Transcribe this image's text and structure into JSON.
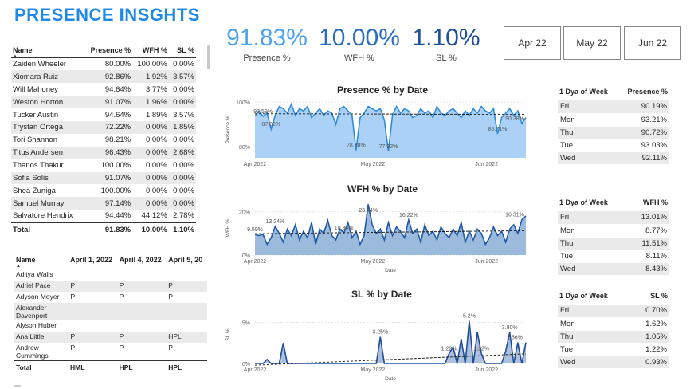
{
  "title": "PRESENCE INSGHTS",
  "kpis": [
    {
      "value": "91.83%",
      "label": "Presence %",
      "color": "#4da3f0"
    },
    {
      "value": "10.00%",
      "label": "WFH %",
      "color": "#2a6cc2"
    },
    {
      "value": "1.10%",
      "label": "SL %",
      "color": "#1f4f9a"
    }
  ],
  "months": [
    "Apr 22",
    "May 22",
    "Jun 22"
  ],
  "employee_table": {
    "headers": [
      "Name",
      "Presence %",
      "WFH %",
      "SL %"
    ],
    "rows": [
      [
        "Zaiden Wheeler",
        "80.00%",
        "100.00%",
        "0.00%"
      ],
      [
        "Xiomara Ruiz",
        "92.86%",
        "1.92%",
        "3.57%"
      ],
      [
        "Will Mahoney",
        "94.64%",
        "3.77%",
        "0.00%"
      ],
      [
        "Weston Horton",
        "91.07%",
        "1.96%",
        "0.00%"
      ],
      [
        "Tucker Austin",
        "94.64%",
        "1.89%",
        "3.57%"
      ],
      [
        "Trystan Ortega",
        "72.22%",
        "0.00%",
        "1.85%"
      ],
      [
        "Tori Shannon",
        "98.21%",
        "0.00%",
        "0.00%"
      ],
      [
        "Titus Andersen",
        "96.43%",
        "0.00%",
        "2.68%"
      ],
      [
        "Thanos Thakur",
        "100.00%",
        "0.00%",
        "0.00%"
      ],
      [
        "Sofia Solis",
        "91.07%",
        "0.00%",
        "0.00%"
      ],
      [
        "Shea Zuniga",
        "100.00%",
        "0.00%",
        "0.00%"
      ],
      [
        "Samuel Murray",
        "97.14%",
        "0.00%",
        "0.00%"
      ],
      [
        "Salvatore Hendrix",
        "94.44%",
        "44.12%",
        "2.78%"
      ]
    ],
    "total": [
      "Total",
      "91.83%",
      "10.00%",
      "1.10%"
    ]
  },
  "attendance_table": {
    "headers": [
      "Name",
      "April 1, 2022",
      "April 4, 2022",
      "April 5, 20"
    ],
    "rows": [
      [
        "Aditya Walls",
        "",
        "",
        ""
      ],
      [
        "Adriel Pace",
        "P",
        "P",
        "P"
      ],
      [
        "Adyson Moyer",
        "P",
        "P",
        "P"
      ],
      [
        "Alexander Davenport",
        "",
        "",
        ""
      ],
      [
        "Alyson Huber",
        "",
        "",
        ""
      ],
      [
        "Ana Little",
        "P",
        "P",
        "HPL"
      ],
      [
        "Andrew Cummings",
        "P",
        "P",
        "P"
      ]
    ],
    "total": [
      "Total",
      "HML",
      "HPL",
      "HPL"
    ]
  },
  "weekday_tables": [
    {
      "headers": [
        "1 Dya of Week",
        "Presence %"
      ],
      "rows": [
        [
          "Fri",
          "90.19%"
        ],
        [
          "Mon",
          "93.21%"
        ],
        [
          "Thu",
          "90.72%"
        ],
        [
          "Tue",
          "93.03%"
        ],
        [
          "Wed",
          "92.11%"
        ]
      ]
    },
    {
      "headers": [
        "1 Dya of Week",
        "WFH %"
      ],
      "rows": [
        [
          "Fri",
          "13.01%"
        ],
        [
          "Mon",
          "8.77%"
        ],
        [
          "Thu",
          "11.51%"
        ],
        [
          "Tue",
          "8.11%"
        ],
        [
          "Wed",
          "8.43%"
        ]
      ]
    },
    {
      "headers": [
        "1 Dya of Week",
        "SL %"
      ],
      "rows": [
        [
          "Fri",
          "0.70%"
        ],
        [
          "Mon",
          "1.62%"
        ],
        [
          "Thu",
          "1.05%"
        ],
        [
          "Tue",
          "1.22%"
        ],
        [
          "Wed",
          "0.93%"
        ]
      ]
    }
  ],
  "chart_data": [
    {
      "type": "area",
      "title": "Presence % by Date",
      "ylabel": "Presence %",
      "xlabel": "",
      "ylim": [
        75,
        100
      ],
      "yticks": [
        "80%",
        "100%"
      ],
      "xticks": [
        "Apr 2022",
        "May 2022",
        "Jun 2022"
      ],
      "fill": "#9ccaf5",
      "line": "#2f8be0",
      "values": [
        93.6,
        96,
        93.59,
        95,
        87.82,
        94,
        98,
        97,
        95,
        99,
        94,
        97,
        96,
        98,
        93,
        95,
        97,
        94,
        96,
        95,
        90,
        97,
        98,
        96,
        94,
        78.38,
        93,
        95,
        98,
        97,
        96,
        97,
        92,
        77.92,
        94,
        98,
        95,
        97,
        96,
        93,
        94,
        97,
        95,
        96,
        93,
        98,
        95,
        94,
        96,
        97,
        95,
        93,
        96,
        94,
        97,
        95,
        98,
        96,
        95,
        97,
        85.71,
        93,
        95,
        97,
        94,
        96,
        90.38,
        93
      ],
      "labels": [
        {
          "i": 2,
          "text": "93.59%"
        },
        {
          "i": 4,
          "text": "87.82%"
        },
        {
          "i": 25,
          "text": "78.38%"
        },
        {
          "i": 33,
          "text": "77.92%"
        },
        {
          "i": 60,
          "text": "85.71%"
        },
        {
          "i": 66,
          "text": "90.38%"
        }
      ]
    },
    {
      "type": "area",
      "title": "WFH % by Date",
      "ylabel": "WFH %",
      "xlabel": "Date",
      "ylim": [
        0,
        25
      ],
      "yticks": [
        "0%",
        "20%"
      ],
      "xticks": [
        "Apr 2022",
        "May 2022",
        "Jun 2022"
      ],
      "fill": "#8aaed6",
      "line": "#1f5aa8",
      "values": [
        9.59,
        9,
        9.5,
        5,
        8,
        13.24,
        10,
        6,
        12,
        9,
        14,
        7,
        11,
        8,
        15,
        5,
        12,
        10,
        16,
        9,
        7,
        12,
        10.34,
        15,
        8,
        11,
        5,
        9,
        23.44,
        14,
        10,
        12,
        7,
        15,
        9,
        13,
        11,
        8,
        16.22,
        10,
        12,
        6,
        14,
        9,
        11,
        7,
        13,
        10,
        8,
        12,
        9,
        15,
        6,
        11,
        7,
        12,
        10,
        5,
        8,
        13,
        9,
        11,
        6,
        12,
        14,
        10,
        16.31,
        18
      ],
      "labels": [
        {
          "i": 0,
          "text": "9.59%"
        },
        {
          "i": 5,
          "text": "13.24%"
        },
        {
          "i": 22,
          "text": "10.34%"
        },
        {
          "i": 28,
          "text": "23.44%"
        },
        {
          "i": 38,
          "text": "16.22%"
        },
        {
          "i": 66,
          "text": "16.31%"
        }
      ]
    },
    {
      "type": "area",
      "title": "SL % by Date",
      "ylabel": "SL %",
      "xlabel": "Date",
      "ylim": [
        0,
        7
      ],
      "yticks": [
        "0%",
        "5%"
      ],
      "xticks": [
        "Apr 2022",
        "May 2022",
        "Jun 2022"
      ],
      "fill": "#9fb4d4",
      "line": "#1f4f9a",
      "values": [
        0,
        0,
        0,
        0.5,
        0,
        0,
        0,
        2.5,
        0,
        0,
        0,
        0,
        0,
        0,
        0,
        0,
        0,
        0,
        0,
        0,
        0,
        0,
        0,
        0,
        0,
        0,
        0,
        0,
        0,
        0,
        0,
        3.25,
        0,
        0,
        0,
        0,
        0,
        0,
        0,
        0,
        0,
        0,
        0,
        0,
        0,
        0,
        0,
        0,
        1.22,
        2,
        0,
        3,
        0,
        5.2,
        0,
        3.8,
        1.22,
        0,
        0,
        0,
        0,
        0,
        1.5,
        3.8,
        0,
        2.56,
        0,
        2.56
      ],
      "labels": [
        {
          "i": 31,
          "text": "3.25%"
        },
        {
          "i": 48,
          "text": "1.22%"
        },
        {
          "i": 53,
          "text": "5.2%"
        },
        {
          "i": 56,
          "text": "1.22%"
        },
        {
          "i": 63,
          "text": "3.80%"
        },
        {
          "i": 67,
          "text": "2.56%"
        }
      ]
    }
  ]
}
